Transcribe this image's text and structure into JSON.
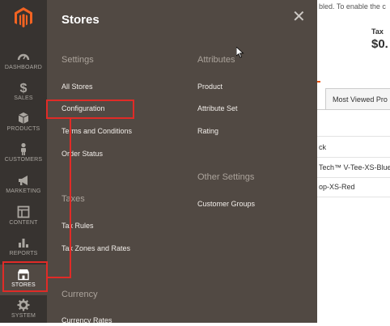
{
  "left_nav": {
    "items": [
      {
        "label": "DASHBOARD",
        "icon": "speedometer-icon"
      },
      {
        "label": "SALES",
        "icon": "dollar-icon"
      },
      {
        "label": "PRODUCTS",
        "icon": "cube-icon"
      },
      {
        "label": "CUSTOMERS",
        "icon": "person-icon"
      },
      {
        "label": "MARKETING",
        "icon": "megaphone-icon"
      },
      {
        "label": "CONTENT",
        "icon": "layout-icon"
      },
      {
        "label": "REPORTS",
        "icon": "bar-chart-icon"
      },
      {
        "label": "STORES",
        "icon": "storefront-icon"
      },
      {
        "label": "SYSTEM",
        "icon": "gear-icon"
      }
    ],
    "active": "STORES"
  },
  "panel": {
    "title": "Stores",
    "close_glyph": "✕",
    "settings": {
      "heading": "Settings",
      "links": [
        "All Stores",
        "Configuration",
        "Terms and Conditions",
        "Order Status"
      ]
    },
    "taxes": {
      "heading": "Taxes",
      "links": [
        "Tax Rules",
        "Tax Zones and Rates"
      ]
    },
    "currency": {
      "heading": "Currency",
      "links": [
        "Currency Rates"
      ]
    },
    "attributes": {
      "heading": "Attributes",
      "links": [
        "Product",
        "Attribute Set",
        "Rating"
      ]
    },
    "other_settings": {
      "heading": "Other Settings",
      "links": [
        "Customer Groups"
      ]
    }
  },
  "background": {
    "notice": "bled. To enable the c",
    "tax_label": "Tax",
    "tax_value": "$0.",
    "tab_label": "Most Viewed Pro",
    "rows": [
      "ck",
      "Tech™ V-Tee-XS-Blue",
      "op-XS-Red"
    ]
  },
  "colors": {
    "nav_bg": "#373330",
    "panel_bg": "#514943",
    "highlight": "#e02b27",
    "logo": "#f26322"
  }
}
